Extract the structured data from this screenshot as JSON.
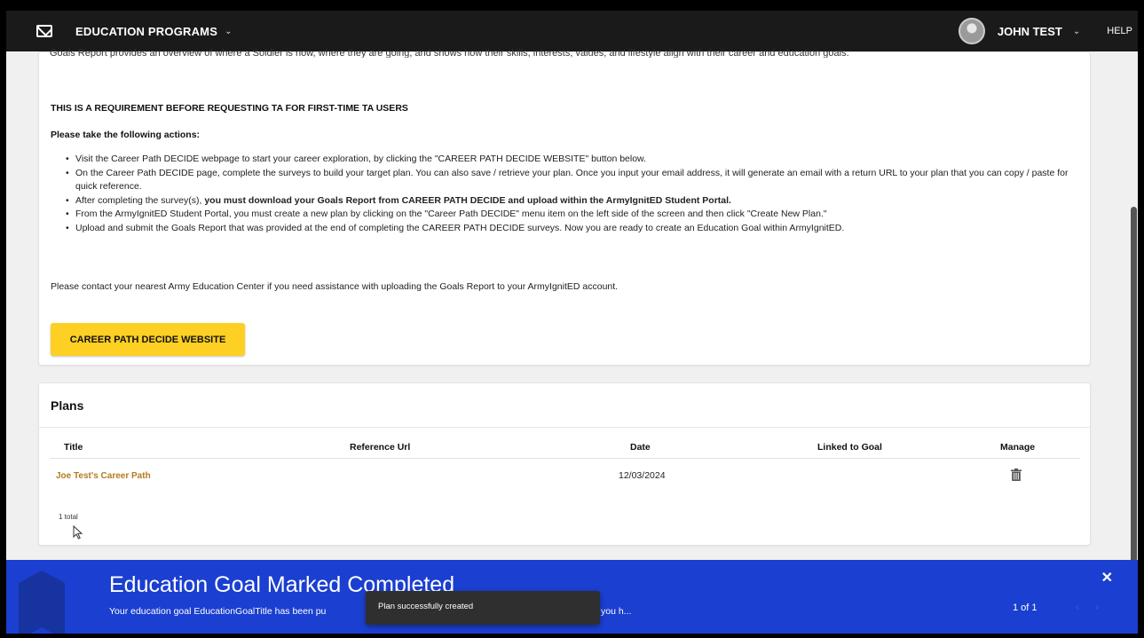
{
  "header": {
    "brand": "EDUCATION PROGRAMS",
    "user_name": "JOHN TEST",
    "help_label": "HELP",
    "chevron": "⌄"
  },
  "info": {
    "cut_text": "Goals Report provides an overview of where a Soldier is now, where they are going, and shows how their skills, interests, values, and lifestyle align with their career and education goals.",
    "requirement": "THIS IS A REQUIREMENT BEFORE REQUESTING TA FOR FIRST-TIME TA USERS",
    "take_actions": "Please take the following actions:",
    "bullet1": "Visit the Career Path DECIDE webpage to start your career exploration, by clicking the \"CAREER PATH DECIDE WEBSITE\" button below.",
    "bullet2": "On the Career Path DECIDE page, complete the surveys to build your target plan. You can also save / retrieve your plan. Once you input your email address, it will generate an email with a return URL to your plan that you can copy / paste for quick reference.",
    "bullet3_pre": "After completing the survey(s), ",
    "bullet3_bold": "you must download your Goals Report from CAREER PATH DECIDE and upload within the ArmyIgnitED Student Portal.",
    "bullet4": "From the ArmyIgnitED Student Portal, you must create a new plan by clicking on the \"Career Path DECIDE\" menu item on the left side of the screen and then click \"Create New Plan.\"",
    "bullet5": "Upload and submit the Goals Report that was provided at the end of completing the CAREER PATH DECIDE surveys. Now you are ready to create an Education Goal within ArmyIgnitED.",
    "contact": "Please contact your nearest Army Education Center if you need assistance with uploading the Goals Report to your ArmyIgnitED account.",
    "button_label": "CAREER PATH DECIDE WEBSITE"
  },
  "plans": {
    "title": "Plans",
    "columns": [
      "Title",
      "Reference Url",
      "Date",
      "Linked to Goal",
      "Manage"
    ],
    "rows": [
      {
        "title": "Joe Test's Career Path",
        "reference_url": "",
        "date": "12/03/2024",
        "linked_to_goal": ""
      }
    ],
    "total": "1 total"
  },
  "notification": {
    "title": "Education Goal Marked Completed",
    "text_start": "Your education goal EducationGoalTitle has been pu",
    "text_end": "you h...",
    "pager": "1 of 1",
    "close": "✕",
    "prev": "‹",
    "next": "›"
  },
  "toast": {
    "message": "Plan successfully created"
  },
  "colors": {
    "topbar": "#1a1a1a",
    "accent_yellow": "#fdd023",
    "link_gold": "#b47a1e",
    "banner_blue": "#1b3fd0"
  }
}
